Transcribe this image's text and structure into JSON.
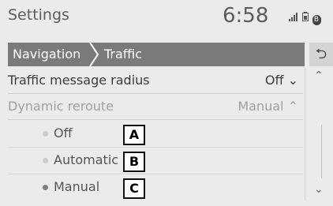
{
  "status": {
    "title": "Settings",
    "time": "6:58",
    "icons": [
      "signal-icon",
      "battery-icon",
      "bluetooth-icon"
    ],
    "bt_glyph": "B"
  },
  "breadcrumb": {
    "items": [
      "Navigation",
      "Traffic"
    ]
  },
  "back_glyph": "⮌",
  "rows": {
    "radius": {
      "label": "Traffic message radius",
      "value": "Off ⌄"
    },
    "reroute": {
      "label": "Dynamic reroute",
      "value": "Manual ⌃"
    }
  },
  "options": [
    {
      "label": "Off",
      "callout": "A",
      "selected": false
    },
    {
      "label": "Automatic",
      "callout": "B",
      "selected": false
    },
    {
      "label": "Manual",
      "callout": "C",
      "selected": true
    }
  ],
  "scroll": {
    "up_glyph": "⌃",
    "down_glyph": "⌄"
  },
  "colors": {
    "header_bar": "#7a7a7a",
    "background": "#ebebeb",
    "selected_dot": "#808080"
  }
}
